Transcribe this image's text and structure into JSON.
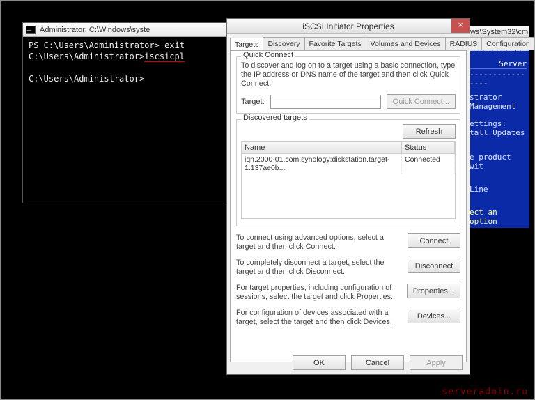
{
  "console": {
    "title": "Administrator: C:\\Windows\\syste",
    "lines": [
      "PS C:\\Users\\Administrator> exit",
      "C:\\Users\\Administrator>iscsicpl",
      "",
      "C:\\Users\\Administrator>"
    ]
  },
  "bluepanel": {
    "title_fragment": "ws\\System32\\cm",
    "line1": "================",
    "server_label": "Server",
    "line2": "----------------",
    "item1": "strator",
    "item2": "Management",
    "settings_label": "ettings:",
    "item3": "tall Updates",
    "item4": "e product wit",
    "item5": "",
    "item6": "Line",
    "prompt": "ect an option"
  },
  "dialog": {
    "title": "iSCSI Initiator Properties",
    "close_glyph": "×",
    "tabs": [
      "Targets",
      "Discovery",
      "Favorite Targets",
      "Volumes and Devices",
      "RADIUS",
      "Configuration"
    ],
    "qc_title": "Quick Connect",
    "qc_help": "To discover and log on to a target using a basic connection, type the IP address or DNS name of the target and then click Quick Connect.",
    "target_label": "Target:",
    "target_value": "",
    "quick_connect_btn": "Quick Connect...",
    "disc_title": "Discovered targets",
    "refresh_btn": "Refresh",
    "col_name": "Name",
    "col_status": "Status",
    "row_name": "iqn.2000-01.com.synology:diskstation.target-1.137ae0b...",
    "row_status": "Connected",
    "connect_text": "To connect using advanced options, select a target and then click Connect.",
    "connect_btn": "Connect",
    "disconnect_text": "To completely disconnect a target, select the target and then click Disconnect.",
    "disconnect_btn": "Disconnect",
    "props_text": "For target properties, including configuration of sessions, select the target and click Properties.",
    "props_btn": "Properties...",
    "devices_text": "For configuration of devices associated with a target, select the target and then click Devices.",
    "devices_btn": "Devices...",
    "ok_btn": "OK",
    "cancel_btn": "Cancel",
    "apply_btn": "Apply"
  },
  "watermark": "serveradmin.ru"
}
